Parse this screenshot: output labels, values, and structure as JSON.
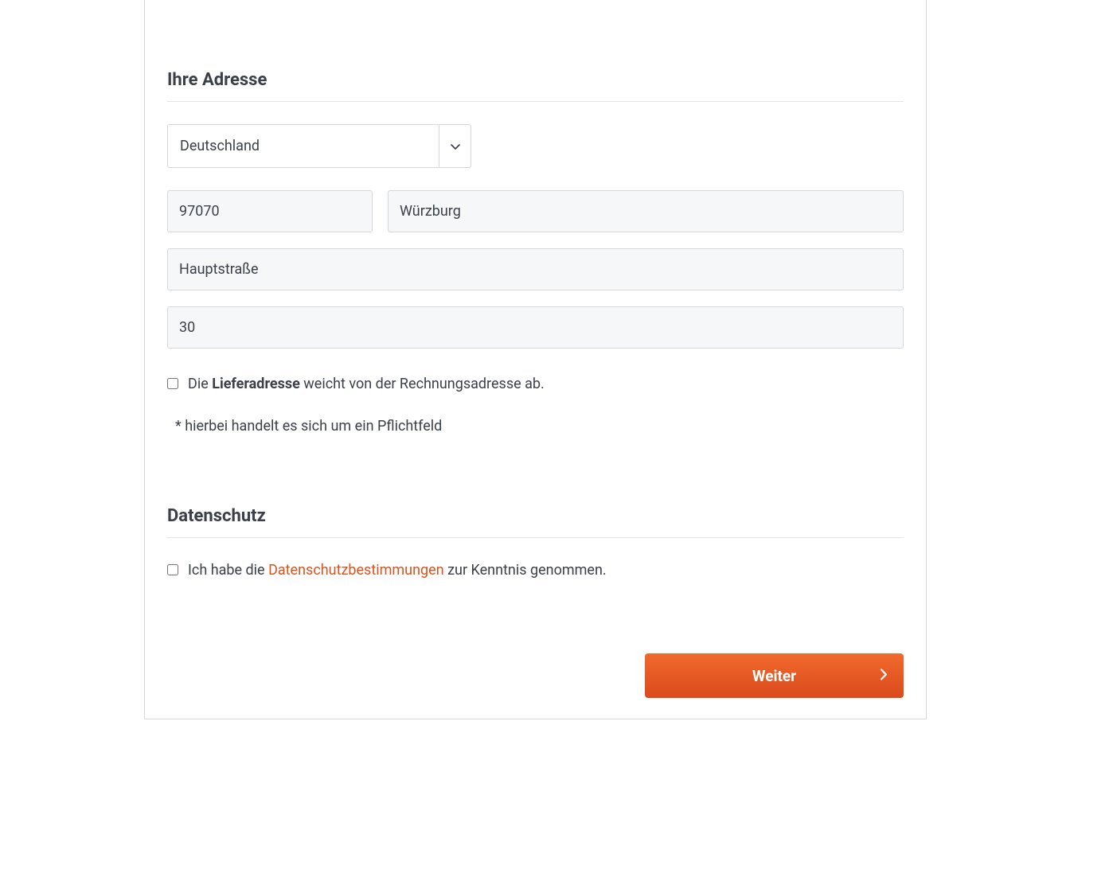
{
  "address": {
    "title": "Ihre Adresse",
    "country": "Deutschland",
    "zip": "97070",
    "city": "Würzburg",
    "street": "Hauptstraße",
    "house_number": "30",
    "shipping_differs_prefix": "Die ",
    "shipping_differs_bold": "Lieferadresse",
    "shipping_differs_suffix": " weicht von der Rechnungsadresse ab.",
    "required_note": "* hierbei handelt es sich um ein Pflichtfeld"
  },
  "privacy": {
    "title": "Datenschutz",
    "prefix": "Ich habe die ",
    "link": "Datenschutzbestimmungen",
    "suffix": " zur Kenntnis genommen."
  },
  "button": {
    "continue": "Weiter"
  }
}
